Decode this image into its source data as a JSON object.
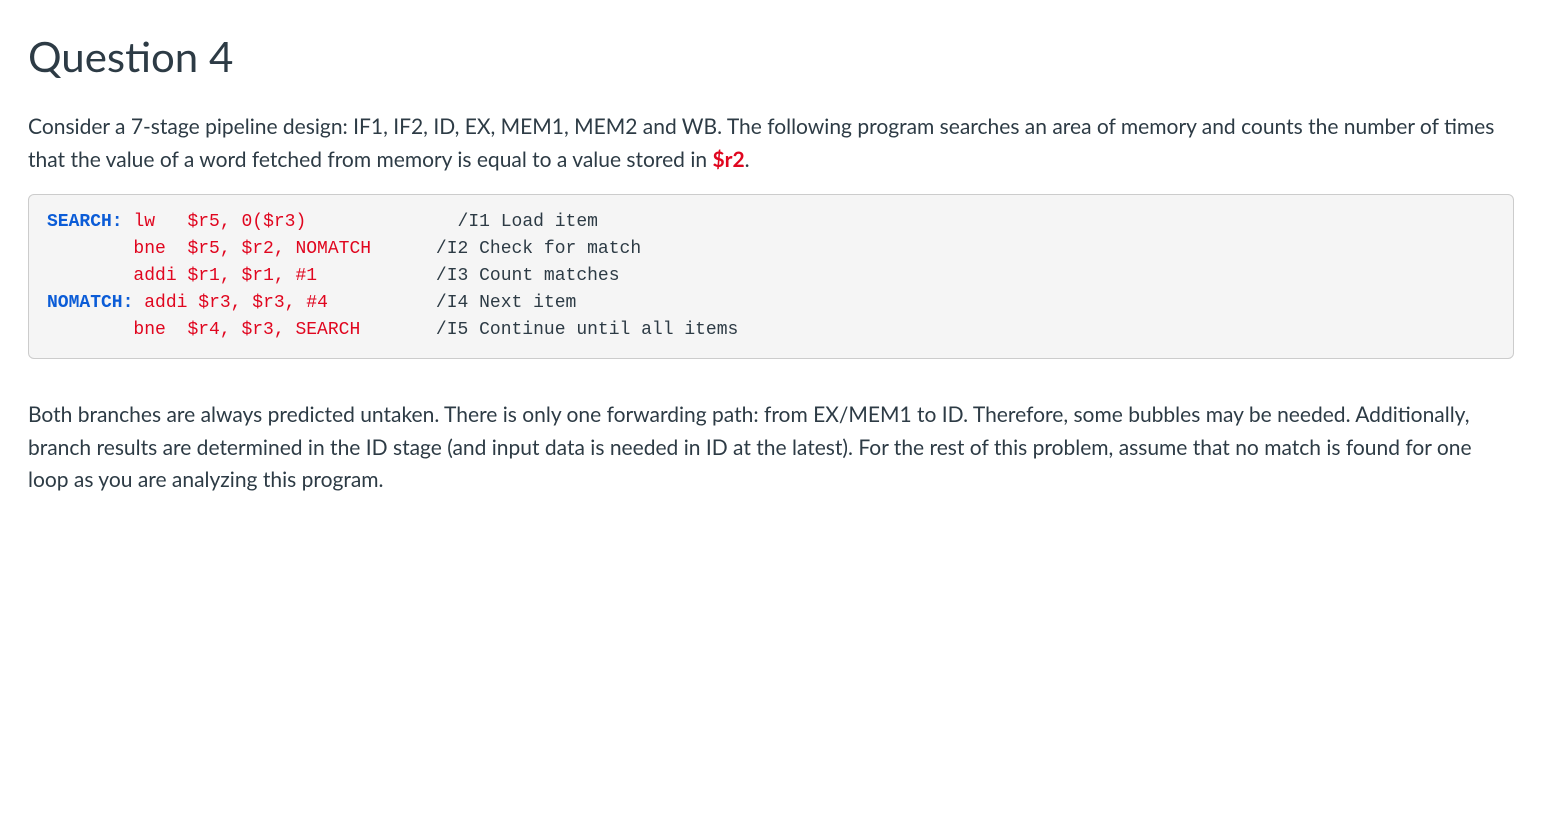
{
  "title": "Question 4",
  "intro_pre": "Consider a 7-stage pipeline design: IF1, IF2, ID, EX, MEM1, MEM2 and WB. The following program searches an area of memory and counts the number of times that the value of a word fetched from memory is equal to a value stored in ",
  "intro_reg": "$r2",
  "intro_post": ".",
  "code": {
    "l1": "SEARCH:",
    "l1_instr": "lw",
    "l1_ops": "$r5, 0($r3)",
    "l1_cmt": "/I1 Load item",
    "l2_instr": "bne",
    "l2_ops": "$r5, $r2, NOMATCH",
    "l2_cmt": "/I2 Check for match",
    "l3_instr": "addi",
    "l3_ops": "$r1, $r1, #1",
    "l3_cmt": "/I3 Count matches",
    "l4": "NOMATCH:",
    "l4_instr": "addi",
    "l4_ops": "$r3, $r3, #4",
    "l4_cmt": "/I4 Next item",
    "l5_instr": "bne",
    "l5_ops": "$r4, $r3, SEARCH",
    "l5_cmt": "/I5 Continue until all items"
  },
  "outro": "Both branches are always predicted untaken. There is only one forwarding path: from EX/MEM1 to ID. Therefore, some bubbles may be needed. Additionally, branch results are determined in the ID stage (and input data is needed in ID at the latest). For the rest of this problem, assume that no match is found for one loop as you are analyzing this program."
}
